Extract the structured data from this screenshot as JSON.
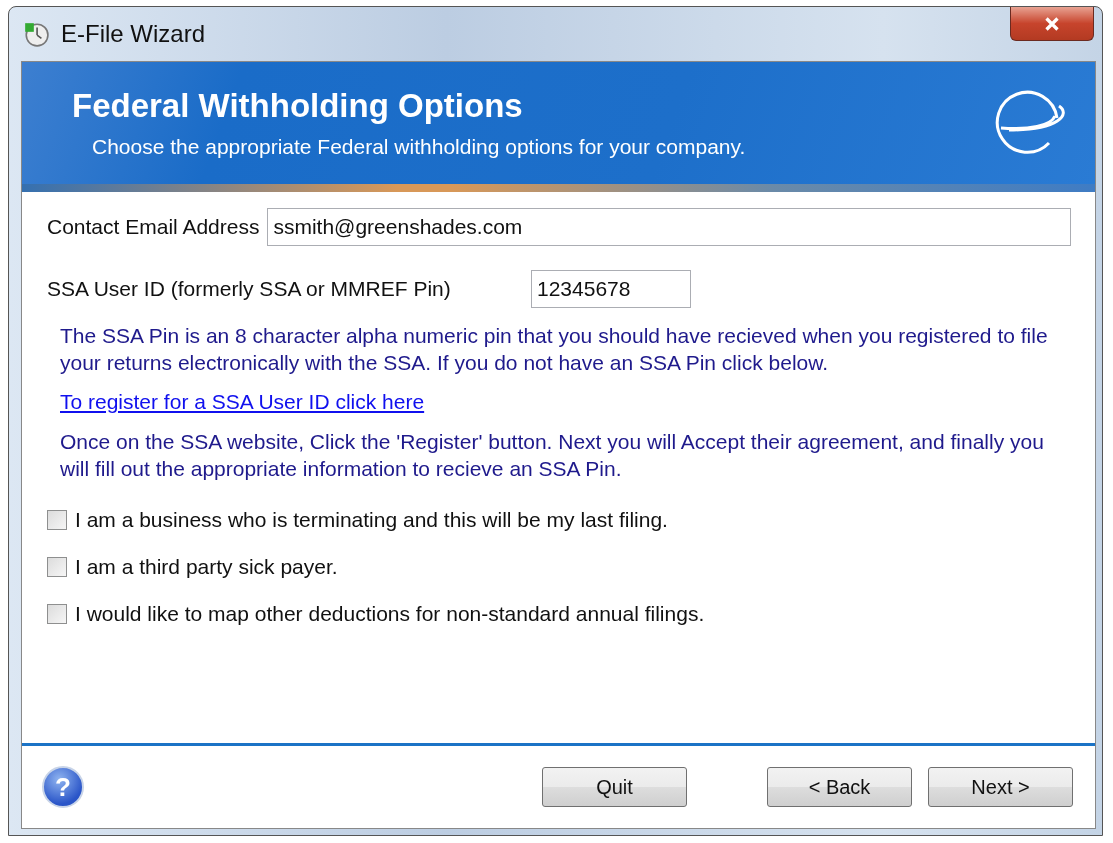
{
  "window": {
    "title": "E-File Wizard"
  },
  "header": {
    "title": "Federal Withholding Options",
    "subtitle": "Choose the appropriate Federal withholding options for your company."
  },
  "email": {
    "label": "Contact Email Address",
    "value": "ssmith@greenshades.com"
  },
  "ssa_id": {
    "label": "SSA User ID (formerly SSA or MMREF Pin)",
    "value": "12345678"
  },
  "pin_info": "The SSA Pin is an 8 character alpha numeric pin that you should have recieved when you registered to file your returns electronically with the SSA.  If you do not have an SSA Pin click below.",
  "register_link": "To register for a SSA User ID click here",
  "register_info": "Once on the SSA website,  Click the 'Register' button.  Next you will Accept their agreement, and finally you  will fill out the appropriate information to recieve an SSA Pin.",
  "options": [
    {
      "label": "I am a business who is terminating and this will be my last filing.",
      "checked": false
    },
    {
      "label": "I am a third party sick payer.",
      "checked": false
    },
    {
      "label": "I would like to map other deductions for non-standard annual filings.",
      "checked": false
    }
  ],
  "help_button": "?",
  "buttons": [
    {
      "label": "Quit",
      "kind": "quit"
    },
    {
      "label": "< Back",
      "kind": "nav"
    },
    {
      "label": "Next >",
      "kind": "nav"
    }
  ]
}
